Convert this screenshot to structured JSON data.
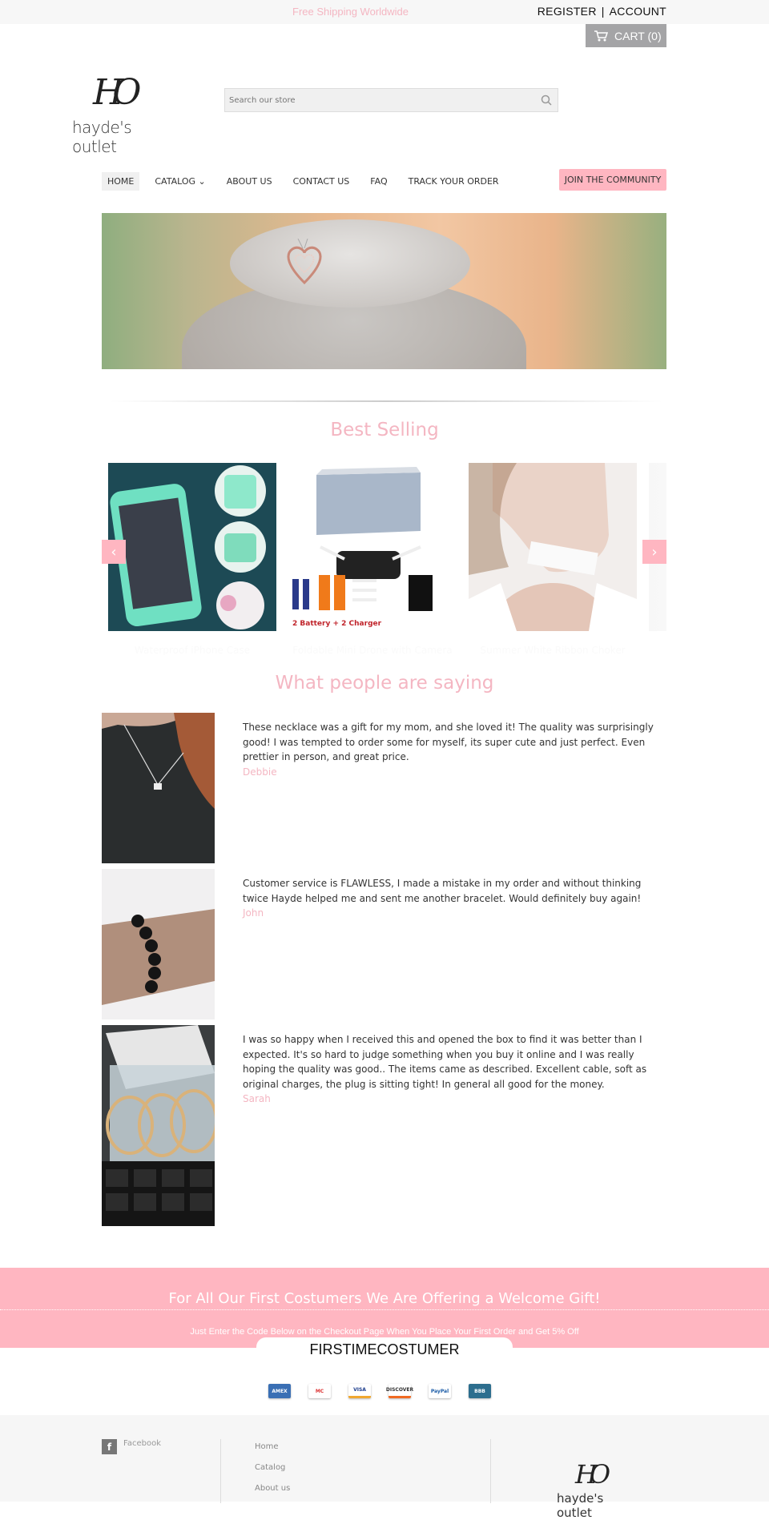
{
  "topbar": {
    "promo": "Free Shipping Worldwide",
    "register": "REGISTER",
    "separator": "|",
    "account": "ACCOUNT"
  },
  "cart": {
    "label": "CART (0)",
    "icon": "cart-icon"
  },
  "logo": {
    "monogram": "HO",
    "name": "hayde's outlet"
  },
  "search": {
    "placeholder": "Search our store",
    "value": "",
    "icon": "search-icon"
  },
  "nav": {
    "items": [
      {
        "label": "HOME",
        "active": true
      },
      {
        "label": "CATALOG ⌄",
        "active": false
      },
      {
        "label": "ABOUT US",
        "active": false
      },
      {
        "label": "CONTACT US",
        "active": false
      },
      {
        "label": "FAQ",
        "active": false
      },
      {
        "label": "TRACK YOUR ORDER",
        "active": false
      }
    ],
    "cta": "JOIN THE COMMUNITY"
  },
  "best_selling": {
    "title": "Best Selling",
    "products": [
      {
        "title": "Waterproof iPhone Case",
        "image": "teal waterproof phone case"
      },
      {
        "title": "Foldable Mini Drone with Camera",
        "image": "black mini drone with 2 batteries",
        "caption": "2 Battery + 2 Charger"
      },
      {
        "title": "Summer White Ribbon Choker",
        "image": "woman wearing white choker"
      }
    ],
    "prev_icon": "‹",
    "next_icon": "›"
  },
  "testimonials": {
    "title": "What people are saying",
    "items": [
      {
        "text": "These necklace was a gift for my mom, and she loved it! The quality was surprisingly good! I was tempted to order some for myself, its super cute and just perfect. Even prettier in person, and great price.",
        "author": "Debbie"
      },
      {
        "text": "Customer service is FLAWLESS, I made a mistake in my order and without thinking twice Hayde helped me and sent me another bracelet. Would definitely buy again!",
        "author": "John"
      },
      {
        "text": "I was so happy when I received this and opened the box to find it was better than I expected. It's so hard to judge something when you buy it online and I was really hoping the quality was good.. The items came as described. Excellent cable, soft as original charges, the plug is sitting tight! In general all good for the money.",
        "author": "Sarah"
      }
    ]
  },
  "gift": {
    "headline": "For All Our First Costumers We Are Offering a Welcome Gift!",
    "subline": "Just Enter the Code Below on the Checkout Page When You Place Your First Order and Get 5% Off",
    "code": "FIRSTIMECOSTUMER"
  },
  "payments": [
    "AMEX",
    "MC",
    "VISA",
    "DISCOVER",
    "PayPal",
    "BBB"
  ],
  "footer": {
    "social": "Facebook",
    "links": [
      "Home",
      "Catalog",
      "About us"
    ],
    "logo_name": "hayde's outlet"
  },
  "colors": {
    "accent": "#ffb6c1",
    "accent_text": "#f4b6c2",
    "cart_bg": "#a4a4a6"
  }
}
